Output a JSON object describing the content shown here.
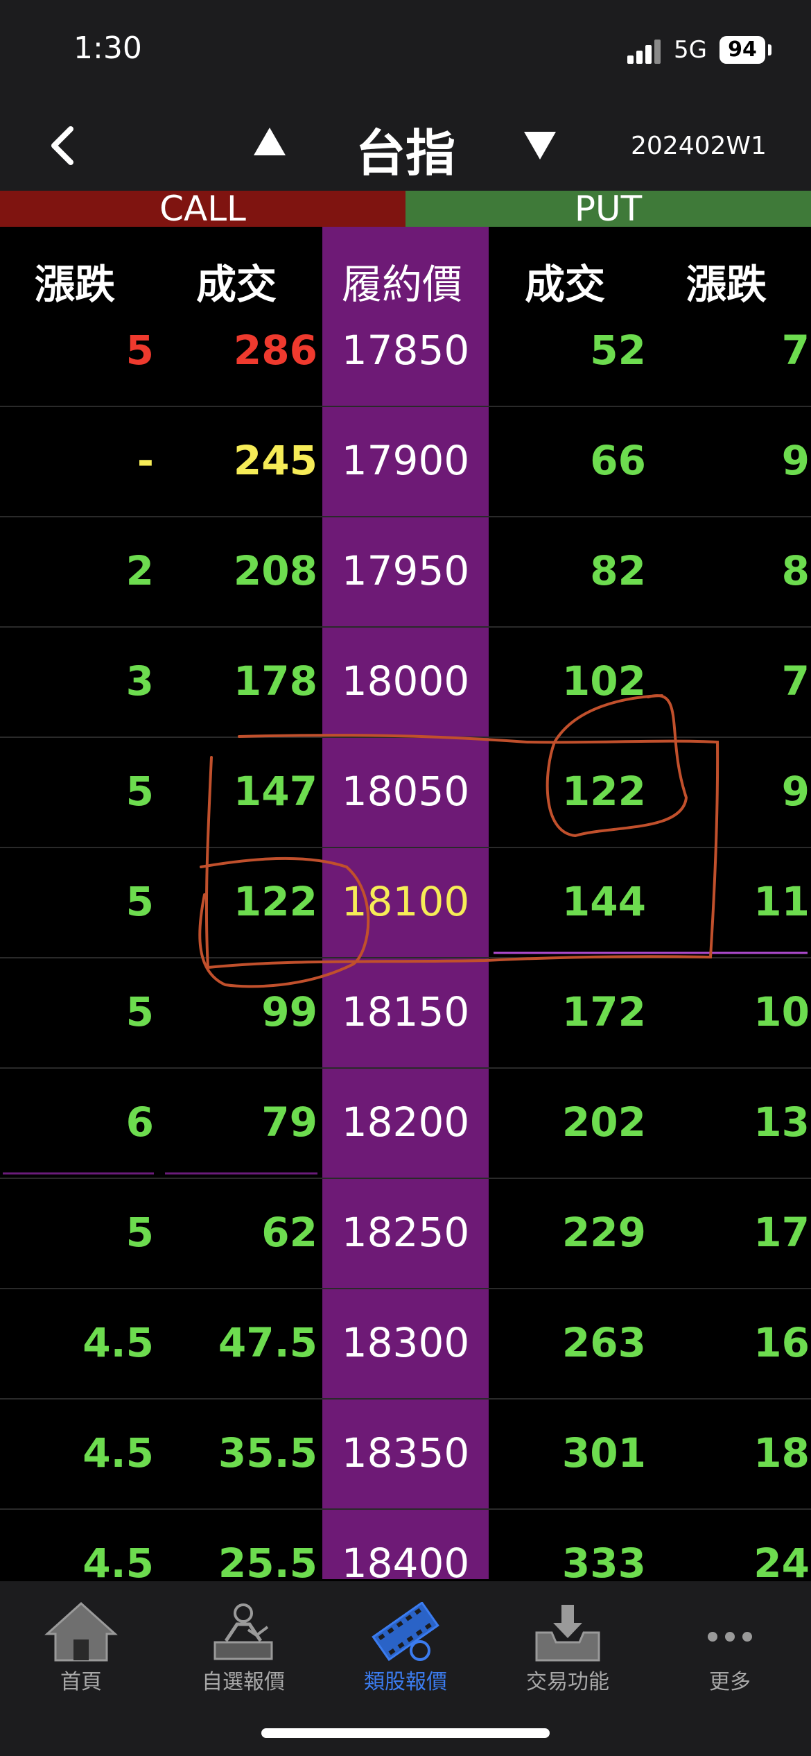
{
  "status_bar": {
    "time": "1:30",
    "network": "5G",
    "battery": "94"
  },
  "nav": {
    "title": "台指",
    "week_code": "202402W1"
  },
  "sections": {
    "call": "CALL",
    "put": "PUT"
  },
  "columns": {
    "call_change": "漲跌",
    "call_volume": "成交",
    "strike": "履約價",
    "put_volume": "成交",
    "put_change": "漲跌"
  },
  "colors": {
    "up_green": "#6ddc4f",
    "down_red": "#ef3a2e",
    "flat_yellow": "#f6ec57",
    "strike_purple": "#6e1a76",
    "call_red": "#7f1410",
    "put_green": "#3f7a39",
    "active_tab": "#3b7cf0"
  },
  "rows": [
    {
      "call_change": "5",
      "call_volume": "286",
      "strike": "17850",
      "put_volume": "52",
      "put_change": "7"
    },
    {
      "call_change": "-",
      "call_volume": "245",
      "strike": "17900",
      "put_volume": "66",
      "put_change": "9"
    },
    {
      "call_change": "2",
      "call_volume": "208",
      "strike": "17950",
      "put_volume": "82",
      "put_change": "8"
    },
    {
      "call_change": "3",
      "call_volume": "178",
      "strike": "18000",
      "put_volume": "102",
      "put_change": "7"
    },
    {
      "call_change": "5",
      "call_volume": "147",
      "strike": "18050",
      "put_volume": "122",
      "put_change": "9"
    },
    {
      "call_change": "5",
      "call_volume": "122",
      "strike": "18100",
      "put_volume": "144",
      "put_change": "11"
    },
    {
      "call_change": "5",
      "call_volume": "99",
      "strike": "18150",
      "put_volume": "172",
      "put_change": "10"
    },
    {
      "call_change": "6",
      "call_volume": "79",
      "strike": "18200",
      "put_volume": "202",
      "put_change": "13"
    },
    {
      "call_change": "5",
      "call_volume": "62",
      "strike": "18250",
      "put_volume": "229",
      "put_change": "17"
    },
    {
      "call_change": "4.5",
      "call_volume": "47.5",
      "strike": "18300",
      "put_volume": "263",
      "put_change": "16"
    },
    {
      "call_change": "4.5",
      "call_volume": "35.5",
      "strike": "18350",
      "put_volume": "301",
      "put_change": "18"
    },
    {
      "call_change": "4.5",
      "call_volume": "25.5",
      "strike": "18400",
      "put_volume": "333",
      "put_change": "24"
    }
  ],
  "tabs": [
    {
      "label": "首頁",
      "icon": "home-icon"
    },
    {
      "label": "自選報價",
      "icon": "person-chart-icon"
    },
    {
      "label": "類股報價",
      "icon": "film-coin-icon",
      "active": true
    },
    {
      "label": "交易功能",
      "icon": "tray-download-icon"
    },
    {
      "label": "更多",
      "icon": "more-dots-icon"
    }
  ]
}
